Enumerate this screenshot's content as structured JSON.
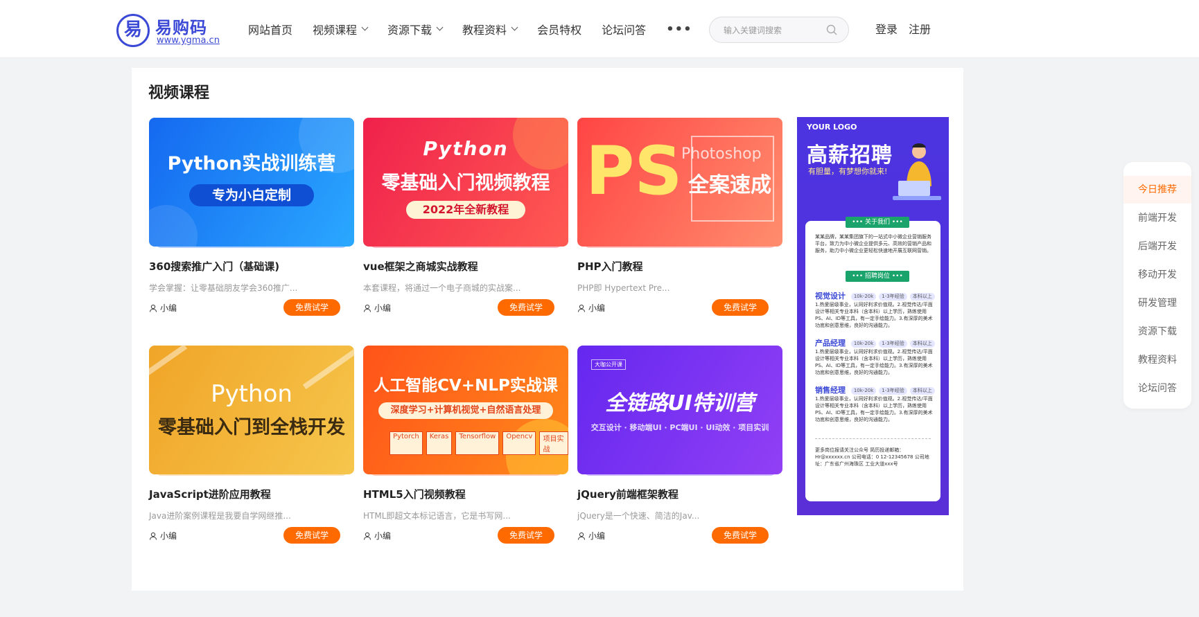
{
  "header": {
    "logo_glyph": "易",
    "logo_title": "易购码",
    "logo_url": "www.ygma.cn",
    "nav": [
      {
        "label": "网站首页",
        "active": true,
        "dropdown": false
      },
      {
        "label": "视频课程",
        "active": false,
        "dropdown": true
      },
      {
        "label": "资源下载",
        "active": false,
        "dropdown": true
      },
      {
        "label": "教程资料",
        "active": false,
        "dropdown": true
      },
      {
        "label": "会员特权",
        "active": false,
        "dropdown": false
      },
      {
        "label": "论坛问答",
        "active": false,
        "dropdown": false
      }
    ],
    "more": "•••",
    "search_placeholder": "输入关键词搜索",
    "login": "登录",
    "register": "注册"
  },
  "section": {
    "title": "视频课程"
  },
  "courses": [
    {
      "thumb_line1": "Python实战训练营",
      "thumb_line2": "专为小白定制",
      "title": "360搜索推广入门（基础课)",
      "desc": "学会掌握：让零基础朋友学会360推广...",
      "author": "小编",
      "button": "免费试学",
      "colors": [
        "#1a6ff5",
        "#27b3ff"
      ]
    },
    {
      "thumb_line1": "Python",
      "thumb_line2": "零基础入门视频教程",
      "thumb_line3": "2022年全新教程",
      "title": "vue框架之商城实战教程",
      "desc": "本套课程，将通过一个电子商城的实战案...",
      "author": "小编",
      "button": "免费试学",
      "colors": [
        "#f2274e",
        "#ff5a52"
      ]
    },
    {
      "thumb_line1": "PS",
      "thumb_line2": "全案速成",
      "thumb_line3": "Photoshop",
      "title": "PHP入门教程",
      "desc": "PHP即 Hypertext Pre...",
      "author": "小编",
      "button": "免费试学",
      "colors": [
        "#ff4f4f",
        "#ff8a6a"
      ]
    },
    {
      "thumb_line1": "Python",
      "thumb_line2": "零基础入门到全栈开发",
      "title": "JavaScript进阶应用教程",
      "desc": "Java进阶案例课程是我要自学网继推...",
      "author": "小编",
      "button": "免费试学",
      "colors": [
        "#f2aa2a",
        "#f7c24a"
      ]
    },
    {
      "thumb_line1": "人工智能CV+NLP实战课",
      "thumb_line2": "深度学习+计算机视觉+自然语言处理",
      "thumb_tags": [
        "Pytorch",
        "Keras",
        "Tensorflow",
        "Opencv",
        "项目实战"
      ],
      "title": "HTML5入门视频教程",
      "desc": "HTML即超文本标记语言，它是书写网...",
      "author": "小编",
      "button": "免费试学",
      "colors": [
        "#ff5a1a",
        "#ff8a1a"
      ]
    },
    {
      "thumb_badge": "大咖公开课",
      "thumb_line1": "全链路UI特训营",
      "thumb_line2": "交互设计 · 移动端UI · PC端UI · UI动效 · 项目实训",
      "title": "jQuery前端框架教程",
      "desc": "jQuery是一个快速、简洁的Jav...",
      "author": "小编",
      "button": "免费试学",
      "colors": [
        "#6a2cf0",
        "#8b3cf5"
      ]
    }
  ],
  "ad": {
    "logo": "YOUR LOGO",
    "title": "高薪招聘",
    "subtitle": "有胆量，有梦想你就来!",
    "about_tag": "••• 关于我们 •••",
    "about_text": "某某品牌，某某集团旗下的一站式中小微企业营销服务平台，致力为中小微企业提供多元、高效的营销产品和服务，助力中小微企业更轻松快速地开展互联网营销。",
    "jobs_tag": "••• 招聘岗位 •••",
    "jobs": [
      {
        "name": "视觉设计",
        "pills": [
          "10k-20k",
          "1-3年经验",
          "本科以上"
        ]
      },
      {
        "name": "产品经理",
        "pills": [
          "10k-20k",
          "1-3年经验",
          "本科以上"
        ]
      },
      {
        "name": "销售经理",
        "pills": [
          "10k-20k",
          "1-3年经验",
          "本科以上"
        ]
      }
    ],
    "job_desc": "1.热爱层级事业，认同好利求价值观。2.视觉传达/平面设计等相关专业本科（含本科）以上学历，熟练使用PS、AI、ID等工具，有一定手绘能力。3.有深厚的美术功底和创意思维，良好的沟通能力。",
    "footer": "更多岗位报请关注公众号 简历投递邮箱：Hr@xxxxxx.cn 公司电话：0 12-12345678 公司地址：广东省广州海珠区 工业大道xxx号"
  },
  "sidebar": [
    {
      "label": "今日推荐",
      "active": true
    },
    {
      "label": "前端开发",
      "active": false
    },
    {
      "label": "后端开发",
      "active": false
    },
    {
      "label": "移动开发",
      "active": false
    },
    {
      "label": "研发管理",
      "active": false
    },
    {
      "label": "资源下载",
      "active": false
    },
    {
      "label": "教程资料",
      "active": false
    },
    {
      "label": "论坛问答",
      "active": false
    }
  ]
}
